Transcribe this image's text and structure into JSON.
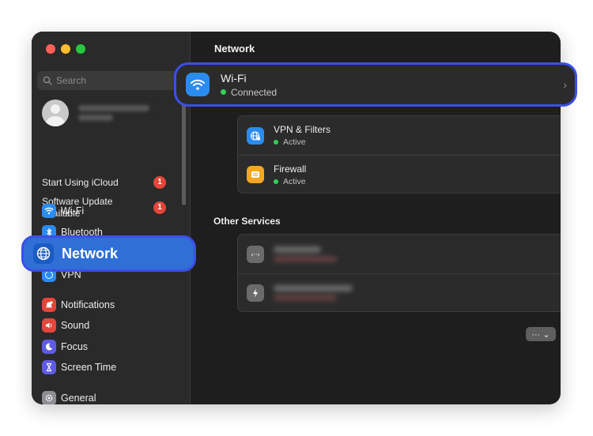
{
  "sidebar": {
    "search_placeholder": "Search",
    "start_icloud": "Start Using iCloud",
    "software_update": "Software Update Available",
    "badge_count": "1",
    "items": [
      {
        "label": "Wi-Fi",
        "icon": "wifi-icon",
        "color": "#2a8cf0"
      },
      {
        "label": "Bluetooth",
        "icon": "bluetooth-icon",
        "color": "#2a8cf0"
      },
      {
        "label": "Network",
        "icon": "globe-icon",
        "color": "#2a8cf0"
      },
      {
        "label": "VPN",
        "icon": "vpn-icon",
        "color": "#2a8cf0"
      },
      {
        "label": "Notifications",
        "icon": "bell-icon",
        "color": "#e5453a"
      },
      {
        "label": "Sound",
        "icon": "speaker-icon",
        "color": "#e5453a"
      },
      {
        "label": "Focus",
        "icon": "moon-icon",
        "color": "#5e5ce6"
      },
      {
        "label": "Screen Time",
        "icon": "hourglass-icon",
        "color": "#5e5ce6"
      },
      {
        "label": "General",
        "icon": "gear-icon",
        "color": "#8e8e93"
      }
    ],
    "selected": "Network"
  },
  "main": {
    "title": "Network",
    "wifi": {
      "name": "Wi-Fi",
      "status": "Connected"
    },
    "services": [
      {
        "name": "VPN & Filters",
        "status": "Active",
        "icon": "globe-lock-icon",
        "color": "#2a8cf0"
      },
      {
        "name": "Firewall",
        "status": "Active",
        "icon": "firewall-icon",
        "color": "#f5a623"
      }
    ],
    "other_services_title": "Other Services",
    "action_label": "··· ⌄",
    "help_label": "?"
  },
  "colors": {
    "accent": "#2a8cf0",
    "highlight_border": "#3c4fe6",
    "status_green": "#30d158",
    "status_red": "#e5453a"
  }
}
